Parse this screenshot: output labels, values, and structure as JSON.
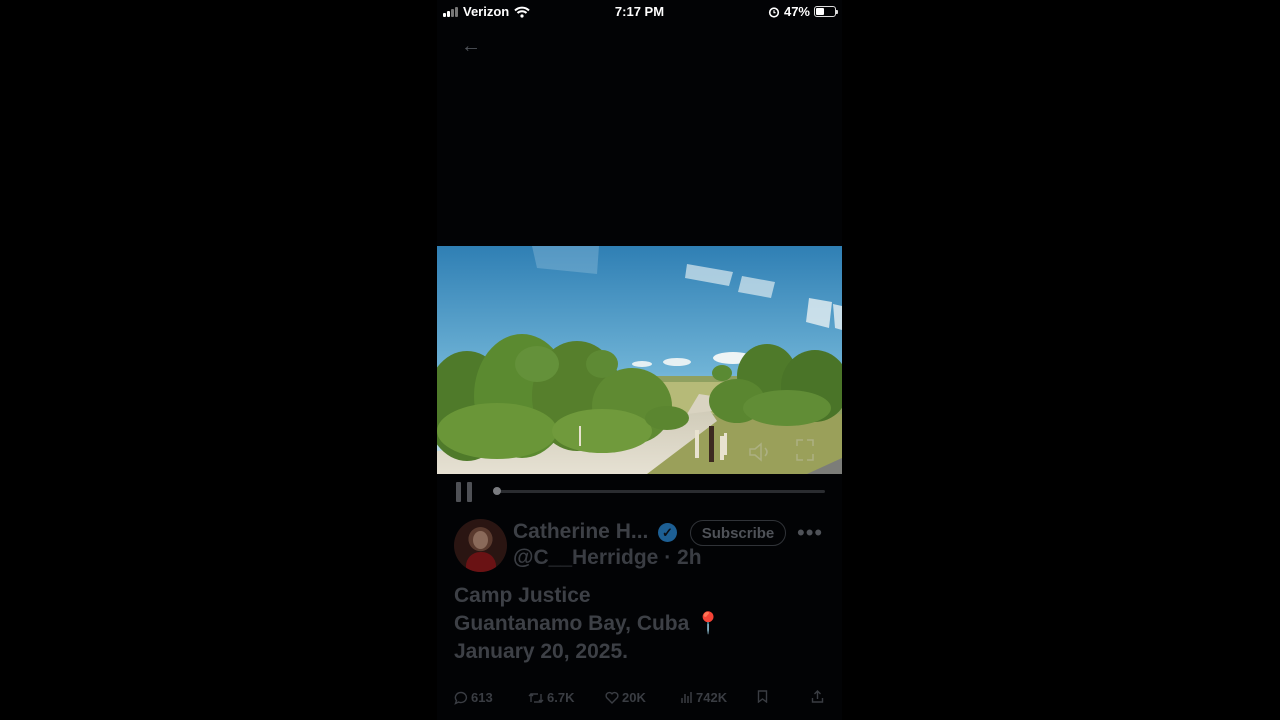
{
  "status_bar": {
    "carrier": "Verizon",
    "time": "7:17 PM",
    "battery": "47%"
  },
  "nav": {
    "back_icon": "arrow-left-icon"
  },
  "video": {
    "state": "playing",
    "progress_fraction": 0.01
  },
  "tweet": {
    "author_name": "Catherine H...",
    "verified": true,
    "handle_time": "@C__Herridge · 2h",
    "subscribe_label": "Subscribe",
    "more_label": "•••",
    "text_lines": [
      "Camp Justice",
      "Guantanamo Bay, Cuba",
      "January 20, 2025."
    ],
    "location_pin": "📍",
    "stats": {
      "replies": "613",
      "reposts": "6.7K",
      "likes": "20K",
      "views": "742K"
    }
  },
  "colors": {
    "background": "#000000",
    "screen": "#020305",
    "dim_text": "#3d4046",
    "verified_badge": "#1d5f94"
  }
}
